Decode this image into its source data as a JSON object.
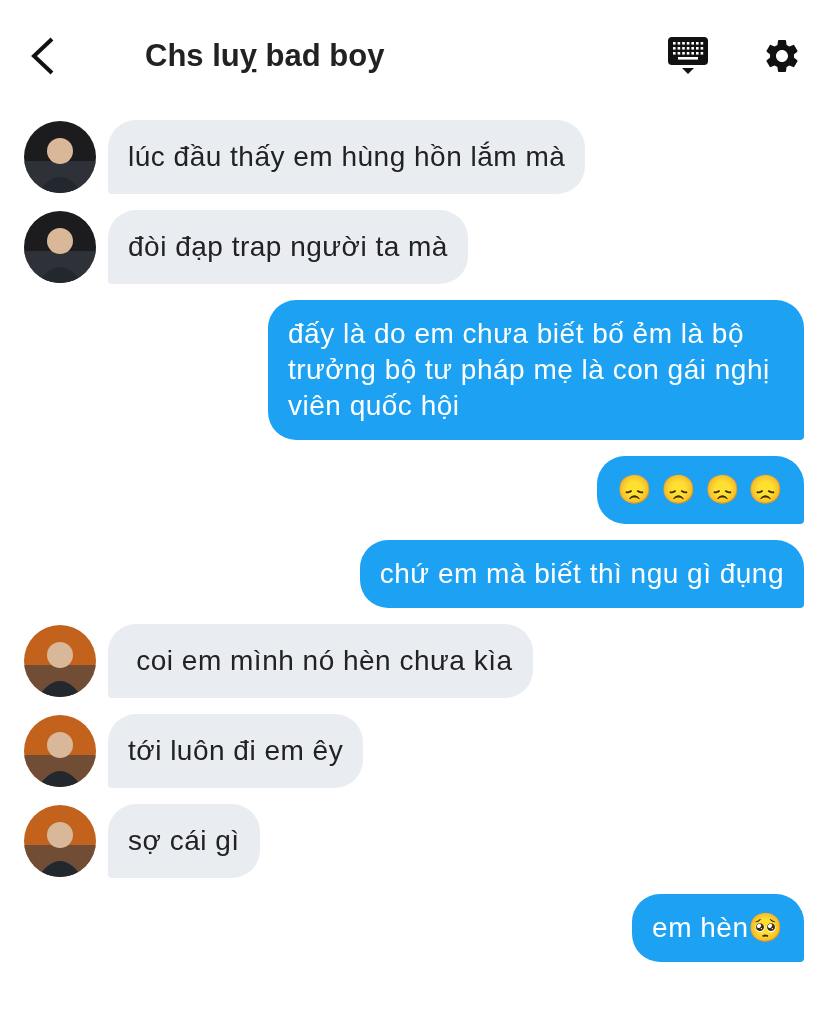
{
  "header": {
    "title": "Chs luỵ bad boy"
  },
  "messages": [
    {
      "kind": "incoming",
      "text": "lúc đầu thấy em hùng hồn lắm mà"
    },
    {
      "kind": "incoming",
      "text": "đòi đạp trap người ta mà"
    },
    {
      "kind": "outgoing",
      "text": "đấy là do em chưa biết bố ẻm là bộ trưởng bộ tư pháp mẹ là con gái nghị viên quốc hội"
    },
    {
      "kind": "outgoing",
      "text": "😞 😞 😞 😞"
    },
    {
      "kind": "outgoing",
      "text": "chứ em mà biết thì ngu gì đụng"
    },
    {
      "kind": "incoming",
      "text": " coi em mình nó hèn chưa kìa"
    },
    {
      "kind": "incoming",
      "text": "tới luôn đi em êy"
    },
    {
      "kind": "incoming",
      "text": "sợ cái gì"
    },
    {
      "kind": "outgoing",
      "text": "em hèn🥺"
    }
  ]
}
